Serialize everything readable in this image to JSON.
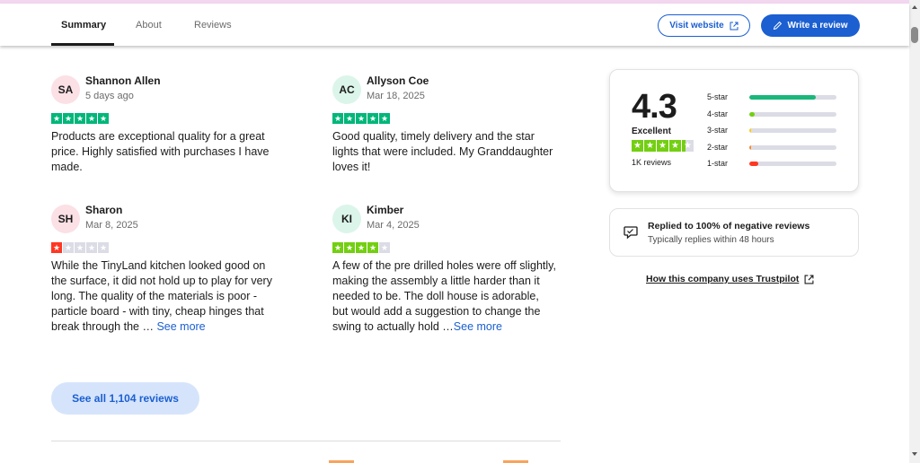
{
  "tabs": [
    {
      "label": "Summary",
      "active": true
    },
    {
      "label": "About",
      "active": false
    },
    {
      "label": "Reviews",
      "active": false
    }
  ],
  "header": {
    "visit_label": "Visit website",
    "write_label": "Write a review",
    "visit_icon": "external-link-icon",
    "write_icon": "pencil-icon"
  },
  "reviews": [
    {
      "initials": "SA",
      "name": "Shannon Allen",
      "date": "5 days ago",
      "rating": 5,
      "avatar_tone": "pink",
      "text": "Products are exceptional quality for a great price. Highly satisfied with purchases I have made.",
      "see_more": ""
    },
    {
      "initials": "AC",
      "name": "Allyson Coe",
      "date": "Mar 18, 2025",
      "rating": 5,
      "avatar_tone": "green",
      "text": "Good quality, timely delivery and the star lights that were included. My Granddaughter loves it!",
      "see_more": ""
    },
    {
      "initials": "SH",
      "name": "Sharon",
      "date": "Mar 8, 2025",
      "rating": 1,
      "avatar_tone": "pink",
      "text": "While the TinyLand kitchen looked good on the surface, it did not hold up to play for very long. The quality of the materials is poor - particle board - with tiny, cheap hinges that break through the … ",
      "see_more": "See more"
    },
    {
      "initials": "KI",
      "name": "Kimber",
      "date": "Mar 4, 2025",
      "rating": 4,
      "avatar_tone": "green",
      "text": "A few of the pre drilled holes were off slightly, making the assembly a little harder than it needed to be. The doll house is adorable, but would add a suggestion to change the swing to actually hold …",
      "see_more": "See more"
    }
  ],
  "see_all_label": "See all 1,104 reviews",
  "summary": {
    "score": "4.3",
    "label": "Excellent",
    "stars": 4.3,
    "count_label": "1K reviews",
    "distribution": [
      {
        "label": "5-star",
        "fraction": 0.76,
        "color": "#1ab77a"
      },
      {
        "label": "4-star",
        "fraction": 0.06,
        "color": "#73cf11"
      },
      {
        "label": "3-star",
        "fraction": 0.02,
        "color": "#ffce00"
      },
      {
        "label": "2-star",
        "fraction": 0.02,
        "color": "#ff8622"
      },
      {
        "label": "1-star",
        "fraction": 0.1,
        "color": "#ff3722"
      }
    ]
  },
  "reply": {
    "title": "Replied to 100% of negative reviews",
    "subtitle": "Typically replies within 48 hours",
    "icon": "chat-bubble-icon"
  },
  "how_link": "How this company uses Trustpilot",
  "star_colors": {
    "5": "#00b67a",
    "4": "#73cf11",
    "3": "#ffce00",
    "2": "#ff8622",
    "1": "#ff3722",
    "empty": "#dcdce6"
  },
  "accent": "#1b5fd1"
}
